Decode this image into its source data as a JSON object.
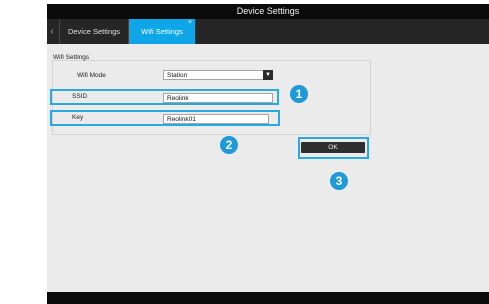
{
  "window": {
    "title": "Device Settings"
  },
  "tabs": {
    "items": [
      {
        "label": "Device Settings"
      },
      {
        "label": "Wifi Settings"
      }
    ],
    "close_glyph": "×",
    "scroll_left_glyph": "‹"
  },
  "wifi": {
    "group_title": "Wifi Settings",
    "mode_label": "Wifi Mode",
    "mode_value": "Station",
    "ssid_label": "SSID",
    "ssid_value": "Reolink",
    "key_label": "Key",
    "key_value": "Reolink01",
    "ok_label": "OK"
  },
  "callouts": [
    "1",
    "2",
    "3"
  ],
  "colors": {
    "accent": "#0ea5e9",
    "callout": "#1e9ad9",
    "highlight": "#29a9e1"
  },
  "icons": {
    "dropdown": "chevron-down-icon"
  }
}
